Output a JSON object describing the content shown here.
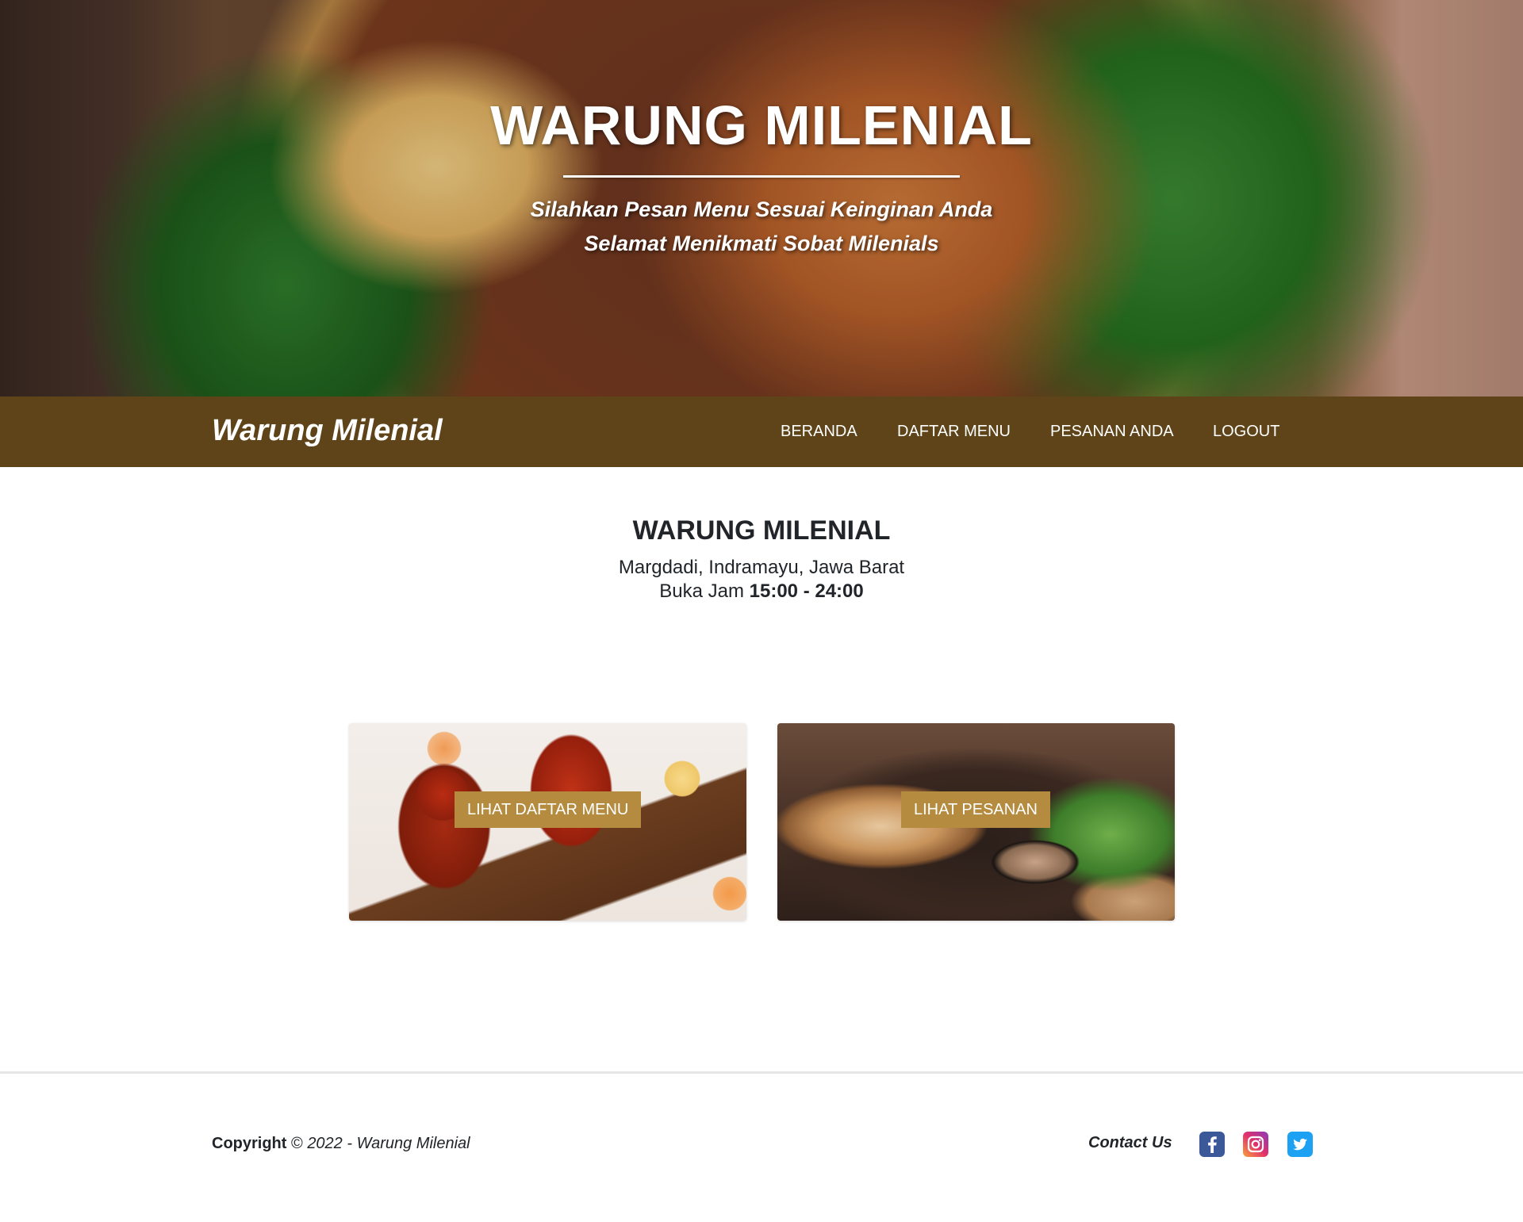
{
  "hero": {
    "title": "WARUNG MILENIAL",
    "subtitle_line1": "Silahkan Pesan Menu Sesuai Keinginan Anda",
    "subtitle_line2": "Selamat Menikmati Sobat Milenials"
  },
  "navbar": {
    "brand": "Warung Milenial",
    "links": [
      {
        "label": "BERANDA"
      },
      {
        "label": "DAFTAR MENU"
      },
      {
        "label": "PESANAN ANDA"
      },
      {
        "label": "LOGOUT"
      }
    ],
    "background": "#5e4418"
  },
  "info": {
    "title": "WARUNG MILENIAL",
    "address": "Margdadi, Indramayu, Jawa Barat",
    "hours_prefix": "Buka Jam",
    "hours": "15:00 - 24:00"
  },
  "cards": [
    {
      "button_label": "LIHAT DAFTAR MENU"
    },
    {
      "button_label": "LIHAT PESANAN"
    }
  ],
  "footer": {
    "copyright_label": "Copyright",
    "copyright_symbol": "©",
    "copyright_text": "2022 - Warung Milenial",
    "contact_label": "Contact Us",
    "social_icons": [
      "facebook-icon",
      "instagram-icon",
      "twitter-icon"
    ]
  },
  "colors": {
    "accent_button": "#b58b3f",
    "navbar": "#5e4418"
  }
}
